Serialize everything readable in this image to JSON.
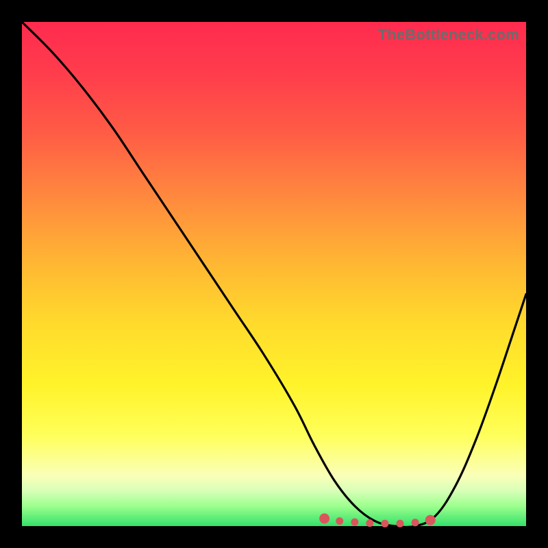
{
  "watermark": "TheBottleneck.com",
  "chart_data": {
    "type": "line",
    "title": "",
    "xlabel": "",
    "ylabel": "",
    "xlim": [
      0,
      100
    ],
    "ylim": [
      0,
      100
    ],
    "series": [
      {
        "name": "bottleneck-curve",
        "x": [
          0,
          6,
          12,
          18,
          24,
          30,
          36,
          42,
          48,
          54,
          58,
          62,
          66,
          70,
          74,
          78,
          82,
          86,
          90,
          94,
          98,
          100
        ],
        "y": [
          100,
          94,
          87,
          79,
          70,
          61,
          52,
          43,
          34,
          24,
          16,
          9,
          4,
          1,
          0,
          0,
          2,
          8,
          17,
          28,
          40,
          46
        ]
      }
    ],
    "markers": {
      "name": "valley-markers",
      "color": "#d9575c",
      "points": [
        {
          "x": 60,
          "y": 1.5
        },
        {
          "x": 63,
          "y": 1.0
        },
        {
          "x": 66,
          "y": 0.8
        },
        {
          "x": 69,
          "y": 0.6
        },
        {
          "x": 72,
          "y": 0.5
        },
        {
          "x": 75,
          "y": 0.5
        },
        {
          "x": 78,
          "y": 0.7
        },
        {
          "x": 81,
          "y": 1.2
        }
      ]
    }
  }
}
